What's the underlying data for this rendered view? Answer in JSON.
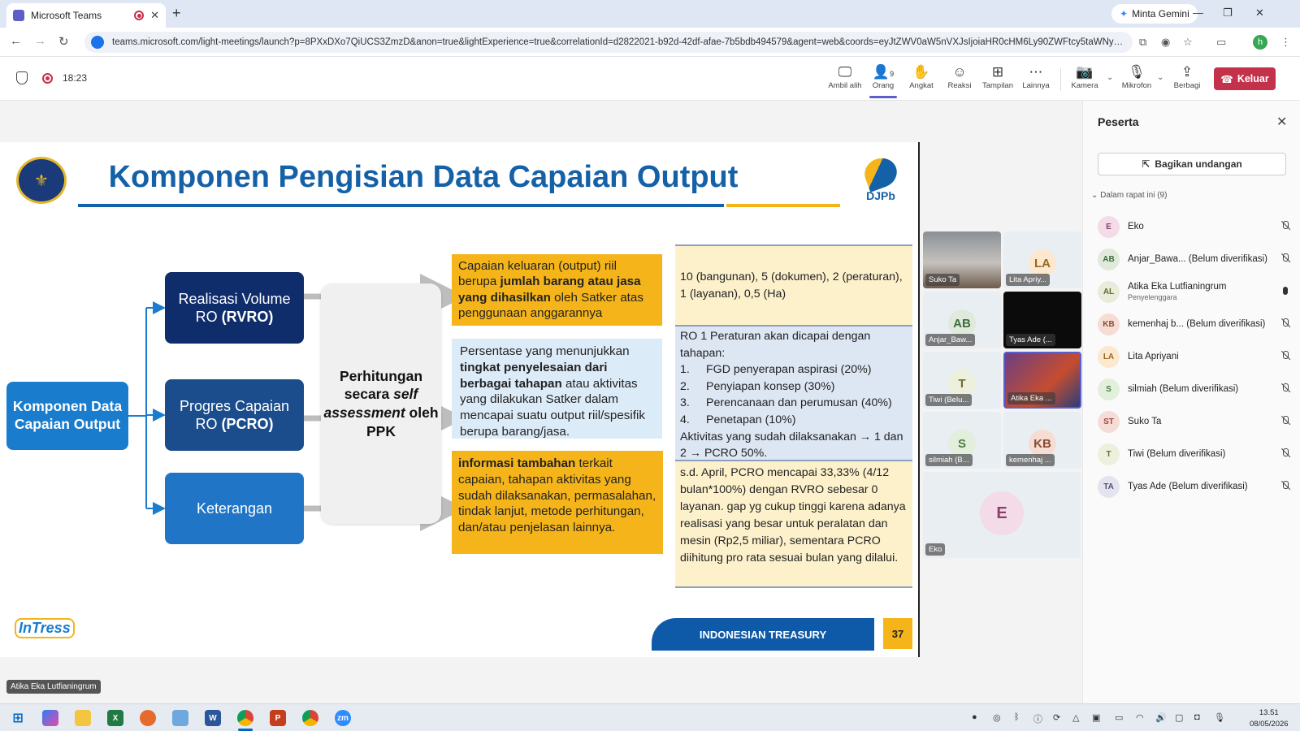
{
  "browser": {
    "tab_title": "Microsoft Teams",
    "new_tab_label": "+",
    "gemini_label": "Minta Gemini",
    "url": "teams.microsoft.com/light-meetings/launch?p=8PXxDXo7QiUCS3ZmzD&anon=true&lightExperience=true&correlationId=d2822021-b92d-42df-afae-7b5bdb494579&agent=web&coords=eyJtZWV0aW5nVXJsIjoiaHR0cHM6Ly90ZWFtcy5taWNyb3NvZnQuY29tL2wvbWVldHVwLWpvaW4vMTk",
    "profile_initial": "h"
  },
  "meeting": {
    "timer": "18:23",
    "toolbar": {
      "ambil_alih": "Ambil alih",
      "orang": "Orang",
      "orang_count": "9",
      "angkat": "Angkat",
      "reaksi": "Reaksi",
      "tampilan": "Tampilan",
      "lainnya": "Lainnya",
      "kamera": "Kamera",
      "mikrofon": "Mikrofon",
      "berbagi": "Berbagi",
      "keluar": "Keluar"
    },
    "speaker_tag": "Atika Eka Lutfianingrum"
  },
  "slide": {
    "title": "Komponen Pengisian Data Capaian Output",
    "logo_text": "DJPb",
    "main_box": "Komponen Data Capaian Output",
    "rvro_line1": "Realisasi Volume",
    "rvro_line2a": "RO ",
    "rvro_line2b": "(RVRO)",
    "pcro_line1": "Progres Capaian",
    "pcro_line2a": "RO ",
    "pcro_line2b": "(PCRO)",
    "ket": "Keterangan",
    "perh_a": "Perhitungan secara ",
    "perh_b": "self assessment",
    "perh_c": " oleh PPK",
    "d1_a": "Capaian keluaran (output) riil berupa ",
    "d1_b": "jumlah barang atau jasa yang dihasilkan",
    "d1_c": " oleh Satker atas penggunaan anggarannya",
    "d2_a": "Persentase yang menunjukkan ",
    "d2_b": "tingkat penyelesaian dari berbagai tahapan",
    "d2_c": " atau aktivitas yang dilakukan Satker dalam mencapai suatu output riil/spesifik berupa barang/jasa.",
    "d3_a": "informasi tambahan",
    "d3_b": " terkait capaian, tahapan aktivitas yang sudah dilaksanakan, permasalahan, tindak lanjut, metode perhitungan, dan/atau penjelasan lainnya.",
    "e1": "10 (bangunan), 5 (dokumen), 2 (peraturan), 1 (layanan), 0,5 (Ha)",
    "e2_intro": "RO 1 Peraturan akan dicapai dengan tahapan:",
    "e2_steps": [
      {
        "n": "1.",
        "t": "FGD penyerapan aspirasi (20%)"
      },
      {
        "n": "2.",
        "t": "Penyiapan konsep (30%)"
      },
      {
        "n": "3.",
        "t": "Perencanaan dan perumusan (40%)"
      },
      {
        "n": "4.",
        "t": "Penetapan (10%)"
      }
    ],
    "e2_outro": "Aktivitas yang sudah dilaksanakan → 1 dan 2 → PCRO 50%.",
    "e3": "s.d. April, PCRO mencapai 33,33% (4/12 bulan*100%) dengan RVRO sebesar 0 layanan. gap yg cukup tinggi karena adanya realisasi yang besar untuk peralatan dan mesin (Rp2,5 miliar), sementara PCRO diihitung pro rata sesuai bulan yang dilalui.",
    "footer": "INDONESIAN TREASURY",
    "page": "37",
    "intress": "InTress"
  },
  "tiles": [
    {
      "name": "Suko Ta",
      "initials": ""
    },
    {
      "name": "Lita Apriy...",
      "initials": "LA"
    },
    {
      "name": "Anjar_Baw...",
      "initials": "AB"
    },
    {
      "name": "Tyas Ade (...",
      "initials": ""
    },
    {
      "name": "Tiwi (Belu...",
      "initials": "T"
    },
    {
      "name": "Atika Eka ...",
      "initials": ""
    },
    {
      "name": "silmiah (B...",
      "initials": "S"
    },
    {
      "name": "kemenhaj ...",
      "initials": "KB"
    },
    {
      "name": "Eko",
      "initials": "E"
    }
  ],
  "panel": {
    "title": "Peserta",
    "share_label": "Bagikan undangan",
    "section": "Dalam rapat ini (9)",
    "participants": [
      {
        "initials": "E",
        "name": "Eko",
        "role": "",
        "color": "#f3dbe8",
        "fg": "#8b3f6b"
      },
      {
        "initials": "AB",
        "name": "Anjar_Bawa... (Belum diverifikasi)",
        "role": "",
        "color": "#dfeadd",
        "fg": "#3f6b3a"
      },
      {
        "initials": "AL",
        "name": "Atika Eka Lutfianingrum",
        "role": "Penyelenggara",
        "color": "#e9ecdb",
        "fg": "#5d6b2d"
      },
      {
        "initials": "KB",
        "name": "kemenhaj b... (Belum diverifikasi)",
        "role": "",
        "color": "#f6ddd4",
        "fg": "#8b4a2f"
      },
      {
        "initials": "LA",
        "name": "Lita Apriyani",
        "role": "",
        "color": "#fbe8cf",
        "fg": "#9a6722"
      },
      {
        "initials": "S",
        "name": "silmiah (Belum diverifikasi)",
        "role": "",
        "color": "#e2efdc",
        "fg": "#4a7a3c"
      },
      {
        "initials": "ST",
        "name": "Suko Ta",
        "role": "",
        "color": "#f6dcd6",
        "fg": "#9a4a3a"
      },
      {
        "initials": "T",
        "name": "Tiwi (Belum diverifikasi)",
        "role": "",
        "color": "#edf0dc",
        "fg": "#6b7130"
      },
      {
        "initials": "TA",
        "name": "Tyas Ade (Belum diverifikasi)",
        "role": "",
        "color": "#e4e4ee",
        "fg": "#4e4e7a"
      }
    ]
  },
  "taskbar": {
    "time": "13.51",
    "date": "08/05/2026"
  }
}
